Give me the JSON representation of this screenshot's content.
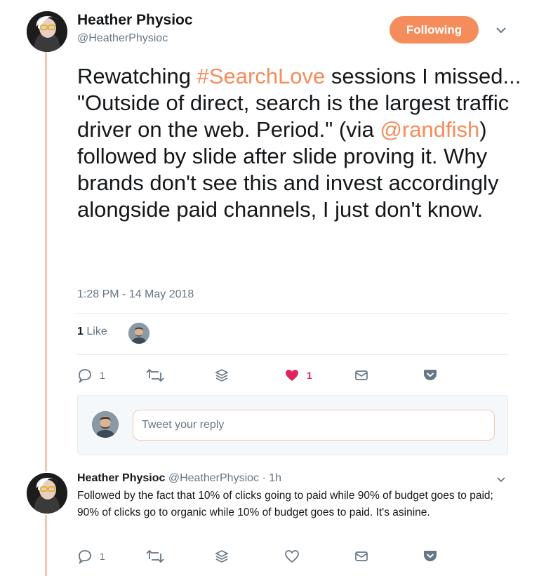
{
  "tweet": {
    "author_name": "Heather Physioc",
    "author_handle": "@HeatherPhysioc",
    "follow_label": "Following",
    "text_parts": {
      "a": "Rewatching ",
      "hashtag": "#SearchLove",
      "b": " sessions I missed... \"Outside of direct, search is the largest traffic driver on the web. Period.\" (via ",
      "mention": "@randfish",
      "c": ") followed by slide after slide proving it. Why brands don't see this and invest accordingly alongside paid channels, I just don't know."
    },
    "timestamp": "1:28 PM - 14 May 2018",
    "likes_count": "1",
    "likes_label": "Like",
    "actions": {
      "reply_count": "1",
      "retweet_icon": "retweet-icon",
      "layers_icon": "layers-icon",
      "like_count": "1",
      "dm_icon": "envelope-icon",
      "pocket_icon": "pocket-icon"
    }
  },
  "reply_composer": {
    "placeholder": "Tweet your reply"
  },
  "reply": {
    "author_name": "Heather Physioc",
    "author_handle": "@HeatherPhysioc",
    "time": "· 1h",
    "text": "Followed by the fact that 10% of clicks going to paid while 90% of budget goes to paid; 90% of clicks go to organic while 10% of budget goes to paid. It's asinine.",
    "reply_count": "1"
  },
  "colors": {
    "accent": "#f58c5c",
    "like_red": "#e0245e",
    "thread_line": "#f5c6b4",
    "muted": "#657786"
  }
}
